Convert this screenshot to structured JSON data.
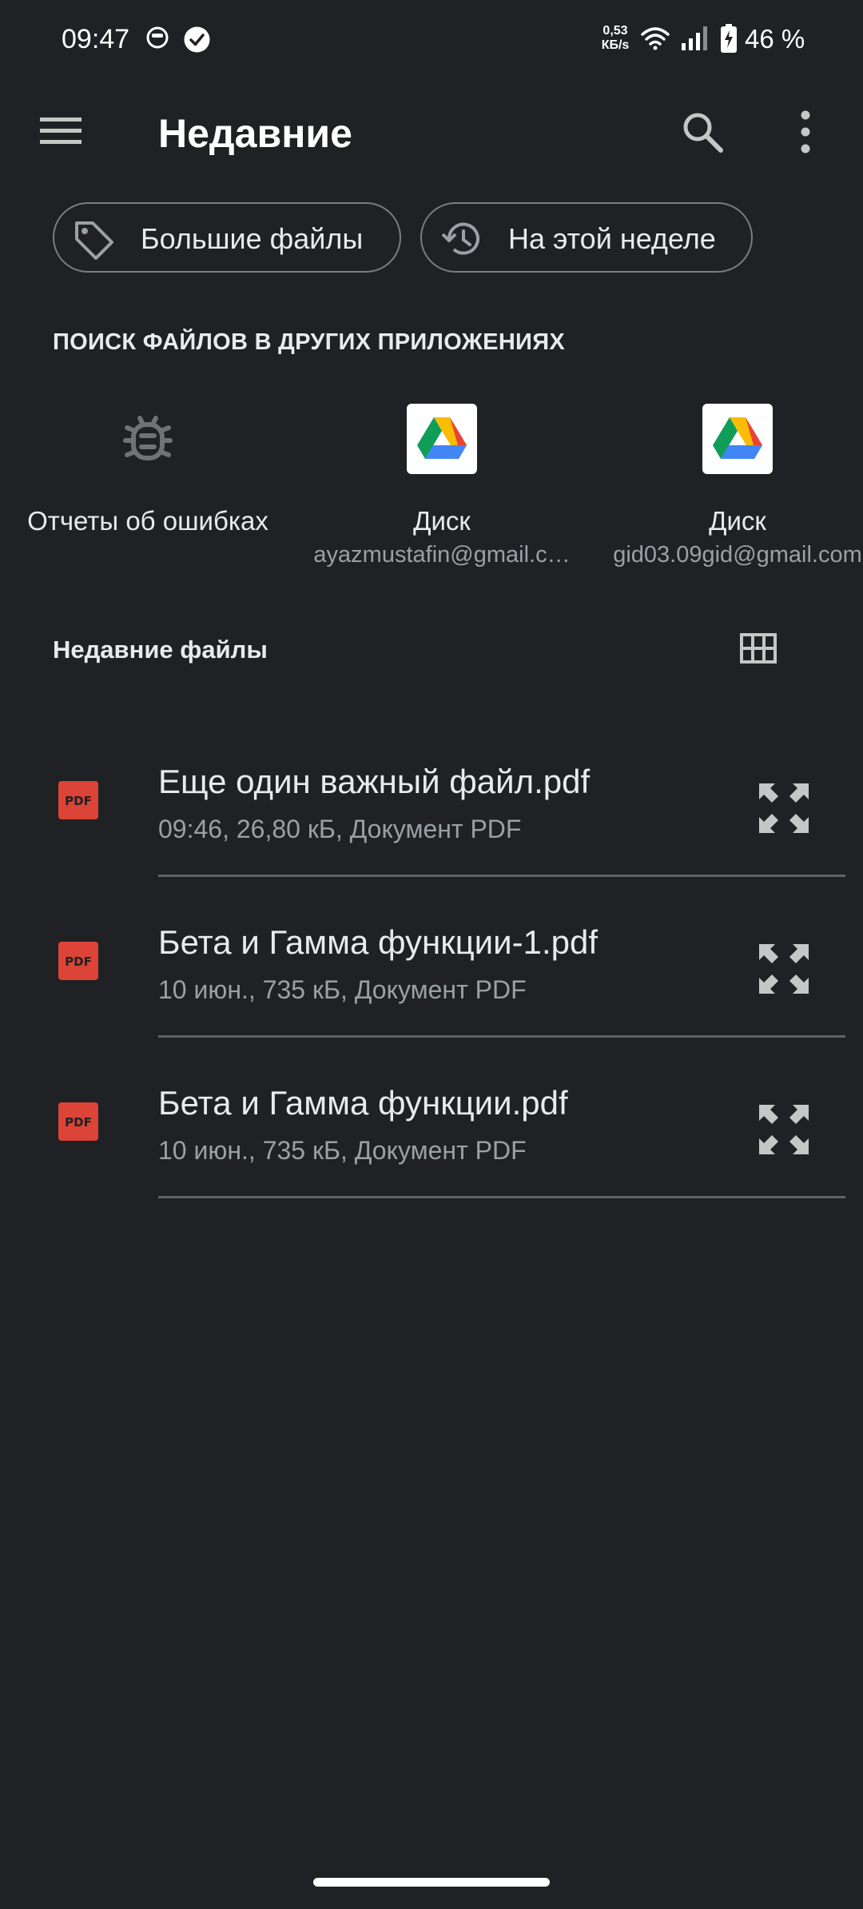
{
  "status_bar": {
    "time": "09:47",
    "net_speed_value": "0,53",
    "net_speed_unit": "КБ/s",
    "battery": "46 %"
  },
  "app_bar": {
    "title": "Недавние",
    "menu_icon": "hamburger-menu-icon",
    "search_icon": "search-icon",
    "more_icon": "more-vert-icon"
  },
  "chips": [
    {
      "label": "Большие файлы",
      "icon": "tag-icon"
    },
    {
      "label": "На этой неделе",
      "icon": "history-icon"
    }
  ],
  "other_apps": {
    "title": "ПОИСК ФАЙЛОВ В ДРУГИХ ПРИЛОЖЕНИЯХ",
    "sources": [
      {
        "name": "Отчеты об ошибках",
        "account": "",
        "icon": "bug-report-icon"
      },
      {
        "name": "Диск",
        "account": "ayazmustafin@gmail.c…",
        "icon": "google-drive-icon"
      },
      {
        "name": "Диск",
        "account": "gid03.09gid@gmail.com",
        "icon": "google-drive-icon"
      }
    ]
  },
  "recent_files": {
    "title": "Недавние файлы",
    "view_icon": "grid-view-icon",
    "items": [
      {
        "name": "Еще один важный файл.pdf",
        "meta": "09:46, 26,80 кБ, Документ PDF",
        "icon_label": "PDF"
      },
      {
        "name": "Бета и Гамма функции-1.pdf",
        "meta": "10 июн., 735 кБ, Документ PDF",
        "icon_label": "PDF"
      },
      {
        "name": "Бета и Гамма функции.pdf",
        "meta": "10 июн., 735 кБ, Документ PDF",
        "icon_label": "PDF"
      }
    ]
  },
  "colors": {
    "background": "#202124",
    "text_primary": "#e8eaed",
    "text_secondary": "#9aa0a6",
    "pdf_red": "#db4437",
    "divider": "#5f6368"
  }
}
